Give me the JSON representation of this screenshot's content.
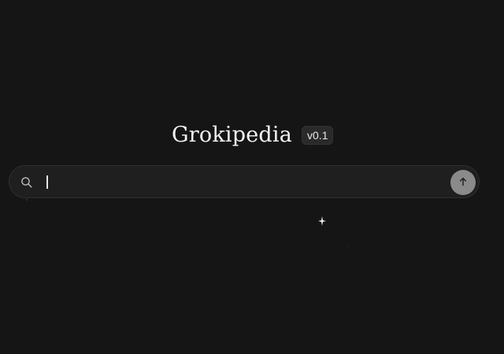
{
  "brand": {
    "title": "Grokipedia",
    "version": "v0.1"
  },
  "search": {
    "value": "",
    "placeholder": "",
    "icon": "search-icon",
    "submit_icon": "arrow-up-icon"
  },
  "decor": {
    "sparkle_icon": "sparkle-icon"
  },
  "colors": {
    "background": "#151515",
    "search_bg": "#1f1f1f",
    "submit_bg": "#8a8a8a",
    "text": "#f5f5f5"
  }
}
